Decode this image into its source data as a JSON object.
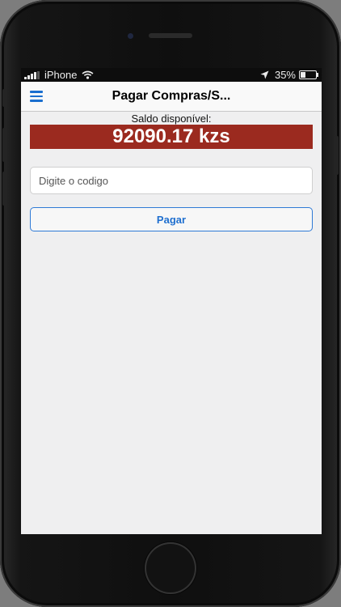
{
  "status_bar": {
    "carrier": "iPhone",
    "battery": "35%",
    "battery_level": 0.35,
    "icons": [
      "signal-icon",
      "wifi-icon",
      "location-arrow-icon",
      "battery-icon"
    ]
  },
  "nav": {
    "title": "Pagar Compras/S...",
    "menu_icon": "hamburger-menu-icon",
    "accent_color": "#1a6fcf"
  },
  "balance": {
    "label": "Saldo disponível:",
    "amount": "92090.17 kzs",
    "background_color": "#9b2a1f"
  },
  "form": {
    "code_placeholder": "Digite o codigo",
    "code_value": "",
    "pay_label": "Pagar"
  }
}
